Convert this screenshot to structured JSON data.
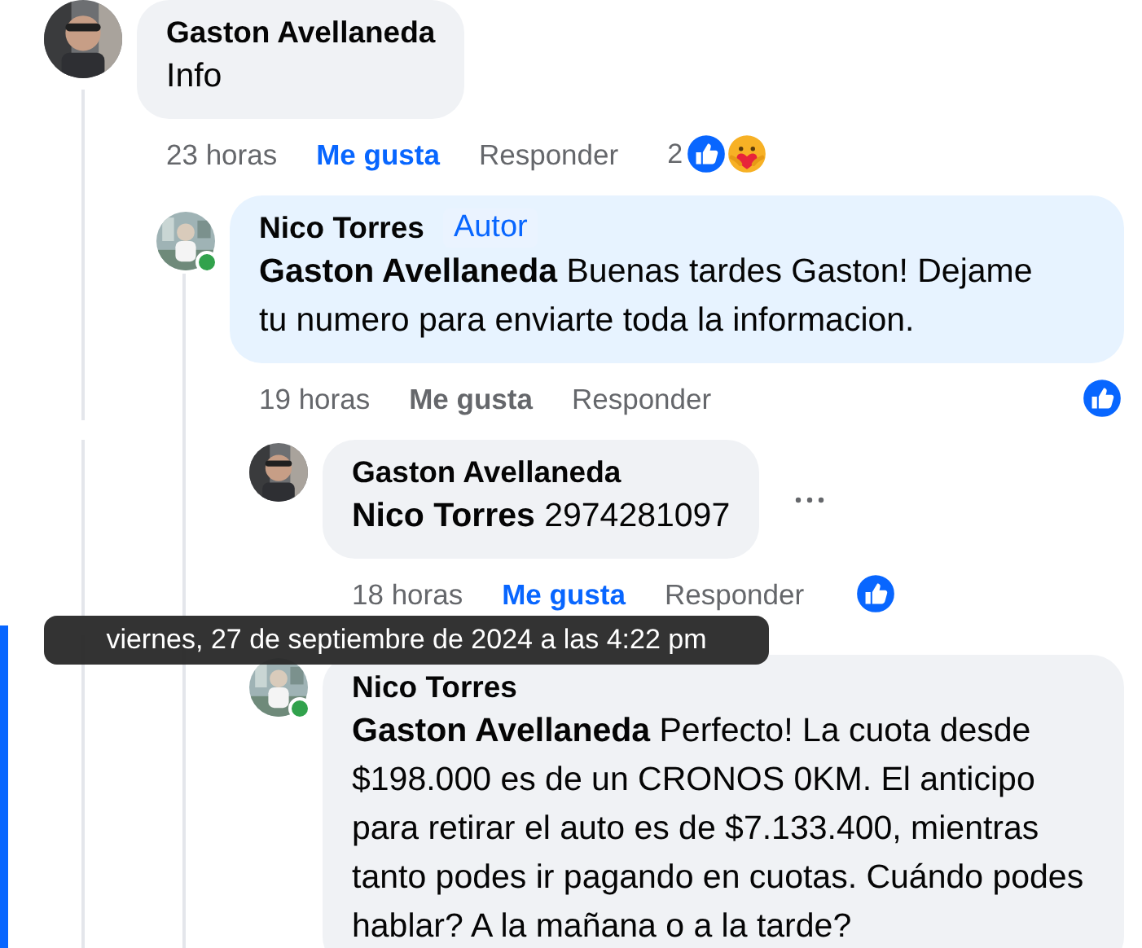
{
  "comments": [
    {
      "author": "Gaston Avellaneda",
      "online": false,
      "text": "Info",
      "time": "23 horas",
      "like_label": "Me gusta",
      "liked": true,
      "reply_label": "Responder",
      "reaction_count": "2",
      "reactions": [
        {
          "kind": "like"
        },
        {
          "kind": "care"
        }
      ],
      "children": [
        {
          "author": "Nico Torres",
          "badge": "Autor",
          "online": true,
          "highlighted": true,
          "text": "**Gaston Avellaneda** Buenas tardes Gaston! Dejame tu numero para enviarte toda la informacion.",
          "time": "19 horas",
          "like_label": "Me gusta",
          "liked": false,
          "reply_label": "Responder",
          "reactions": [
            {
              "kind": "like"
            }
          ],
          "children": [
            {
              "author": "Gaston Avellaneda",
              "online": false,
              "menu": true,
              "text": "**Nico Torres** 2974281097",
              "time": "18 horas",
              "like_label": "Me gusta",
              "liked": true,
              "reply_label": "Responder",
              "reactions": [
                {
                  "kind": "like"
                }
              ]
            },
            {
              "author": "Nico Torres",
              "online": true,
              "focused": true,
              "text": "**Gaston Avellaneda** Perfecto! La cuota desde $198.000 es de un CRONOS 0KM. El anticipo para retirar el auto es de $7.133.400, mientras tanto podes ir pagando en cuotas. Cuándo podes hablar? A la mañana o a la tarde?"
            }
          ]
        }
      ]
    }
  ],
  "tooltip": {
    "text": "viernes, 27 de septiembre de 2024 a las 4:22 pm"
  }
}
